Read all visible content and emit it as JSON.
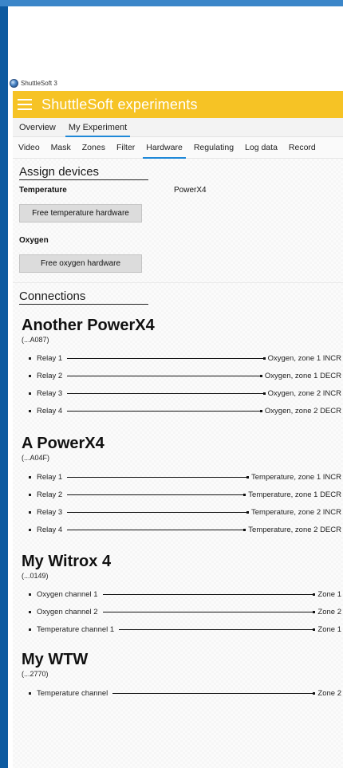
{
  "window": {
    "title": "ShuttleSoft 3"
  },
  "appbar": {
    "title": "ShuttleSoft experiments"
  },
  "tabs_top": [
    {
      "label": "Overview",
      "active": false
    },
    {
      "label": "My Experiment",
      "active": true
    }
  ],
  "tabs_sub": [
    {
      "label": "Video"
    },
    {
      "label": "Mask"
    },
    {
      "label": "Zones"
    },
    {
      "label": "Filter"
    },
    {
      "label": "Hardware",
      "active": true
    },
    {
      "label": "Regulating"
    },
    {
      "label": "Log data"
    },
    {
      "label": "Record"
    }
  ],
  "assign": {
    "title": "Assign devices",
    "temperature_label": "Temperature",
    "temperature_device": "PowerX4",
    "free_temperature": "Free temperature hardware",
    "oxygen_label": "Oxygen",
    "free_oxygen": "Free oxygen hardware"
  },
  "connections": {
    "title": "Connections",
    "devices": [
      {
        "name": "Another PowerX4",
        "id": "(...A087)",
        "links": [
          {
            "source": "Relay 1",
            "target": "Oxygen, zone 1 INCR"
          },
          {
            "source": "Relay 2",
            "target": "Oxygen, zone 1 DECR"
          },
          {
            "source": "Relay 3",
            "target": "Oxygen, zone 2 INCR"
          },
          {
            "source": "Relay 4",
            "target": "Oxygen, zone 2 DECR"
          }
        ]
      },
      {
        "name": "A PowerX4",
        "id": "(...A04F)",
        "links": [
          {
            "source": "Relay 1",
            "target": "Temperature, zone 1 INCR"
          },
          {
            "source": "Relay 2",
            "target": "Temperature, zone 1 DECR"
          },
          {
            "source": "Relay 3",
            "target": "Temperature, zone 2 INCR"
          },
          {
            "source": "Relay 4",
            "target": "Temperature, zone 2 DECR"
          }
        ]
      },
      {
        "name": "My Witrox 4",
        "id": "(...0149)",
        "links": [
          {
            "source": "Oxygen channel 1",
            "target": "Zone 1"
          },
          {
            "source": "Oxygen channel 2",
            "target": "Zone 2"
          },
          {
            "source": "Temperature channel 1",
            "target": "Zone 1"
          }
        ]
      },
      {
        "name": "My WTW",
        "id": "(...2770)",
        "links": [
          {
            "source": "Temperature channel",
            "target": "Zone 2"
          }
        ]
      }
    ]
  }
}
